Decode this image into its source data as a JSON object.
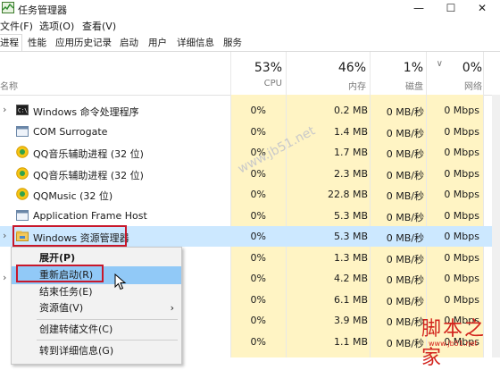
{
  "window": {
    "title": "任务管理器",
    "min": "—",
    "max": "☐",
    "close": "✕"
  },
  "menu": [
    "文件(F)",
    "选项(O)",
    "查看(V)"
  ],
  "tabs": [
    "进程",
    "性能",
    "应用历史记录",
    "启动",
    "用户",
    "详细信息",
    "服务"
  ],
  "columns": {
    "name": "名称",
    "cpu": {
      "pct": "53%",
      "label": "CPU"
    },
    "mem": {
      "pct": "46%",
      "label": "内存"
    },
    "disk": {
      "pct": "1%",
      "label": "磁盘"
    },
    "net": {
      "pct": "0%",
      "label": "网络"
    },
    "sort_arrow": "∨"
  },
  "rows": [
    {
      "name": "Windows 命令处理程序",
      "cpu": "0%",
      "mem": "0.2 MB",
      "disk": "0 MB/秒",
      "net": "0 Mbps",
      "expand": "›",
      "icon": "cmd-icon"
    },
    {
      "name": "COM Surrogate",
      "cpu": "0%",
      "mem": "1.4 MB",
      "disk": "0 MB/秒",
      "net": "0 Mbps",
      "expand": "",
      "icon": "window-icon"
    },
    {
      "name": "QQ音乐辅助进程 (32 位)",
      "cpu": "0%",
      "mem": "1.7 MB",
      "disk": "0 MB/秒",
      "net": "0 Mbps",
      "expand": "",
      "icon": "qqmusic-icon"
    },
    {
      "name": "QQ音乐辅助进程 (32 位)",
      "cpu": "0%",
      "mem": "2.3 MB",
      "disk": "0 MB/秒",
      "net": "0 Mbps",
      "expand": "",
      "icon": "qqmusic-icon"
    },
    {
      "name": "QQMusic (32 位)",
      "cpu": "0%",
      "mem": "22.8 MB",
      "disk": "0 MB/秒",
      "net": "0 Mbps",
      "expand": "",
      "icon": "qqmusic-icon"
    },
    {
      "name": "Application Frame Host",
      "cpu": "0%",
      "mem": "5.3 MB",
      "disk": "0 MB/秒",
      "net": "0 Mbps",
      "expand": "",
      "icon": "window-icon"
    },
    {
      "name": "Windows 资源管理器",
      "cpu": "0%",
      "mem": "5.3 MB",
      "disk": "0 MB/秒",
      "net": "0 Mbps",
      "expand": "›",
      "icon": "explorer-icon"
    },
    {
      "name": "",
      "cpu": "0%",
      "mem": "1.3 MB",
      "disk": "0 MB/秒",
      "net": "0 Mbps",
      "expand": "",
      "icon": ""
    },
    {
      "name": "",
      "cpu": "0%",
      "mem": "4.2 MB",
      "disk": "0 MB/秒",
      "net": "0 Mbps",
      "expand": "›",
      "icon": ""
    },
    {
      "name": "",
      "cpu": "0%",
      "mem": "6.1 MB",
      "disk": "0 MB/秒",
      "net": "0 Mbps",
      "expand": "",
      "icon": ""
    },
    {
      "name": "",
      "cpu": "0%",
      "mem": "3.9 MB",
      "disk": "0 MB/秒",
      "net": "0 Mbps",
      "expand": "",
      "icon": ""
    },
    {
      "name": "",
      "cpu": "0%",
      "mem": "1.1 MB",
      "disk": "0 MB/秒",
      "net": "0 Mbps",
      "expand": "",
      "icon": ""
    }
  ],
  "context_menu": {
    "expand": "展开(P)",
    "restart": "重新启动(R)",
    "end_task": "结束任务(E)",
    "resource_values": "资源值(V)",
    "dump": "创建转储文件(C)",
    "details": "转到详细信息(G)",
    "submenu_arrow": "›"
  },
  "watermark": "www.jb51.net",
  "brand": {
    "name": "脚本之家",
    "url": "www.jb51.net"
  },
  "colors": {
    "heat": "#fff4c4",
    "selection": "#cce8ff",
    "highlight_box": "#c8182b",
    "menu_hover": "#91c9f7"
  }
}
